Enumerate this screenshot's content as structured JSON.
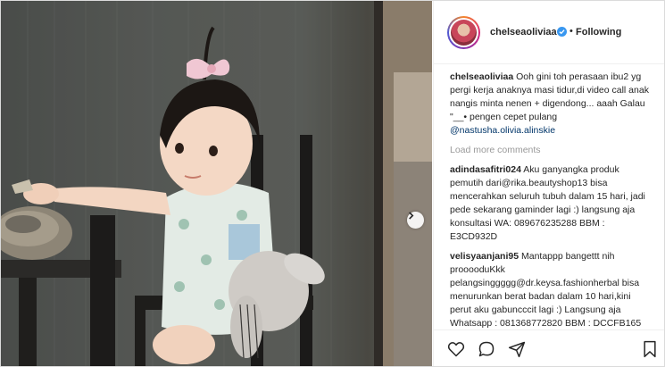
{
  "post": {
    "username": "chelseaoliviaa",
    "verified": true,
    "follow_separator": "•",
    "follow_status": "Following"
  },
  "caption": {
    "username": "chelseaoliviaa",
    "text": "Ooh gini toh perasaan ibu2 yg pergi kerja anaknya masi tidur,di video call anak nangis minta nenen + digendong... aaah Galau \"__• pengen cepet pulang",
    "mention": "@nastusha.olivia.alinskie"
  },
  "load_more_label": "Load more comments",
  "comments": [
    {
      "username": "adindasafitri024",
      "text": "Aku ganyangka produk pemutih dari@rika.beautyshop13 bisa mencerahkan seluruh tubuh dalam 15 hari, jadi pede sekarang gaminder lagi :) langsung aja konsultasi WA: 089676235288 BBM : E3CD932D"
    },
    {
      "username": "velisyaanjani95",
      "text": "Mantappp bangettt nih prooooduKkk pelangsinggggg@dr.keysa.fashionherbal bisa menurunkan berat badan dalam 10 hari,kini perut aku gabuncccit lagi :) Langsung aja Whatsapp : 081368772820 BBM : DCCFB165"
    }
  ],
  "icons": {
    "like": "heart-icon",
    "comment": "comment-icon",
    "share": "share-icon",
    "save": "bookmark-icon",
    "next": "chevron-right-icon",
    "verified": "verified-badge-icon"
  },
  "colors": {
    "verified_blue": "#3897f0",
    "mention_blue": "#003569",
    "muted_gray": "#999999"
  }
}
